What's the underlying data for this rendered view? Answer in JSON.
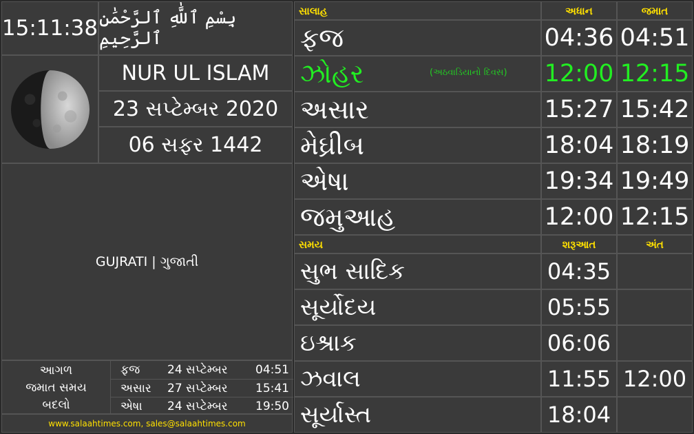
{
  "clock": "15:11:38",
  "bismillah": "بِسْمِ ٱللَّٰهِ ٱلرَّحْمَٰنِ ٱلرَّحِيمِ",
  "masjid": "NUR UL ISLAM",
  "gregorian_date": "23 સપ્ટેમ્બર 2020",
  "hijri_date": "06 સફર 1442",
  "language": "GUJRATI | ગુજાતી",
  "salah_header": {
    "name": "સાલાહ",
    "adhan": "અધાન",
    "jamaat": "જમાત"
  },
  "salah": [
    {
      "name": "ફજ",
      "adhan": "04:36",
      "jamaat": "04:51",
      "note": ""
    },
    {
      "name": "ઝોહર",
      "adhan": "12:00",
      "jamaat": "12:15",
      "note": "(અઠવાડિયાનો દિવસ)",
      "active": true
    },
    {
      "name": "અસાર",
      "adhan": "15:27",
      "jamaat": "15:42",
      "note": ""
    },
    {
      "name": "મેઘ્રીબ",
      "adhan": "18:04",
      "jamaat": "18:19",
      "note": ""
    },
    {
      "name": "એષા",
      "adhan": "19:34",
      "jamaat": "19:49",
      "note": ""
    },
    {
      "name": "જમુઆહ",
      "adhan": "12:00",
      "jamaat": "12:15",
      "note": ""
    }
  ],
  "times_header": {
    "name": "સમય",
    "start": "શરૂઆત",
    "end": "અંત"
  },
  "times": [
    {
      "name": "સુભ સાદિક",
      "start": "04:35",
      "end": ""
    },
    {
      "name": "સૂર્યોદય",
      "start": "05:55",
      "end": ""
    },
    {
      "name": "ઇશ્રાક",
      "start": "06:06",
      "end": ""
    },
    {
      "name": "ઝવાલ",
      "start": "11:55",
      "end": "12:00"
    },
    {
      "name": "સૂર્યાસ્ત",
      "start": "18:04",
      "end": ""
    }
  ],
  "changes": {
    "label": [
      "આગળ",
      "જમાત સમય",
      "બદલો"
    ],
    "rows": [
      {
        "prayer": "ફજ",
        "date": "24 સપ્ટેમ્બર",
        "time": "04:51"
      },
      {
        "prayer": "અસાર",
        "date": "27 સપ્ટેમ્બર",
        "time": "15:41"
      },
      {
        "prayer": "એષા",
        "date": "24 સપ્ટેમ્બર",
        "time": "19:50"
      }
    ]
  },
  "footer": "www.salaahtimes.com, sales@salaahtimes.com",
  "colors": {
    "accent": "#ffe000",
    "active": "#22ee22",
    "panel": "#3a3a3a",
    "border": "#555555"
  }
}
